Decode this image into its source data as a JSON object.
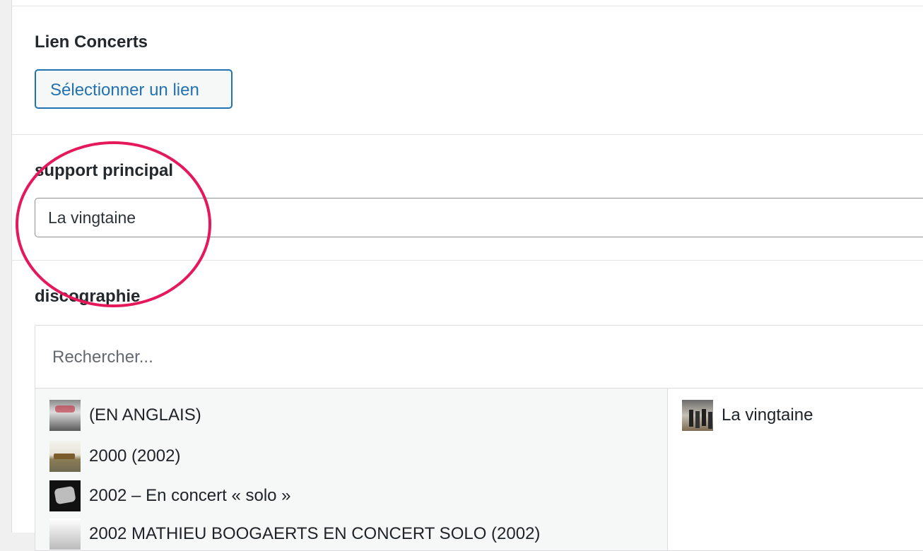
{
  "fields": {
    "lien_concerts": {
      "label": "Lien Concerts",
      "button_label": "Sélectionner un lien"
    },
    "support_principal": {
      "label": "support principal",
      "value": "La vingtaine"
    },
    "discographie": {
      "label": "discographie",
      "search_placeholder": "Rechercher...",
      "choices": [
        {
          "label": "(EN ANGLAIS)",
          "thumb": "album-cover-face"
        },
        {
          "label": "2000 (2002)",
          "thumb": "album-cover-field"
        },
        {
          "label": "2002 – En concert « solo »",
          "thumb": "album-cover-dark"
        },
        {
          "label": "2002 MATHIEU BOOGAERTS EN CONCERT SOLO (2002)",
          "thumb": "album-cover-partial"
        }
      ],
      "selected": [
        {
          "label": "La vingtaine",
          "thumb": "album-cover-group"
        }
      ]
    }
  },
  "colors": {
    "accent": "#2271b1",
    "annotation_circle": "#e5185b"
  }
}
